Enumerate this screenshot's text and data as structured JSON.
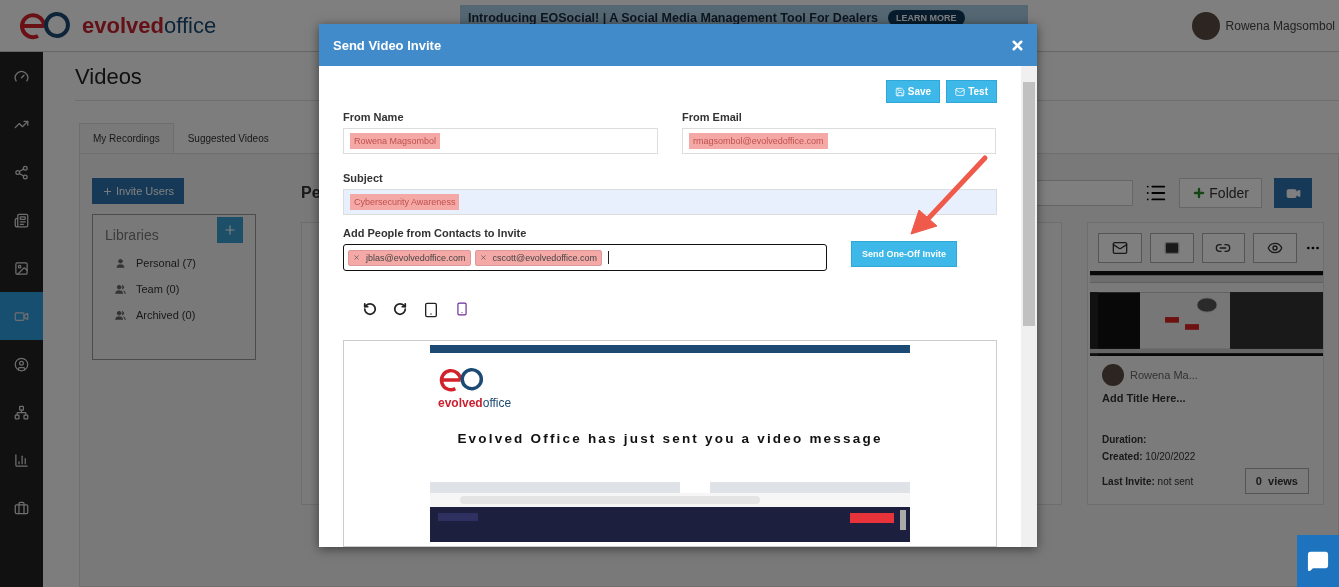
{
  "header": {
    "logo_text": [
      "evolved",
      "office"
    ],
    "banner": {
      "text": "Introducing EOSocial! | A Social Media Management Tool For Dealers",
      "button": "LEARN MORE"
    },
    "user": "Rowena Magsombol"
  },
  "sidebar": {
    "items": [
      {
        "selected": false
      },
      {
        "selected": false
      },
      {
        "selected": false
      },
      {
        "selected": false
      },
      {
        "selected": false
      },
      {
        "selected": true
      },
      {
        "selected": false
      },
      {
        "selected": false
      },
      {
        "selected": false
      },
      {
        "selected": false
      }
    ]
  },
  "page_title": "Videos",
  "tabs": [
    {
      "label": "My Recordings",
      "selected": true
    },
    {
      "label": "Suggested Videos",
      "selected": false
    }
  ],
  "invite_button": "Invite Users",
  "libraries": {
    "title": "Libraries",
    "items": [
      {
        "label": "Personal (7)",
        "kind": "single"
      },
      {
        "label": "Team (0)",
        "kind": "group"
      },
      {
        "label": "Archived (0)",
        "kind": "group"
      }
    ]
  },
  "section_heading": "Pe",
  "folder_button": "Folder",
  "card": {
    "author": "Rowena Ma...",
    "title": "Add Title Here...",
    "duration": "Duration:",
    "created_label": "Created:",
    "created": "10/20/2022",
    "last_invite_label": "Last Invite:",
    "last_invite": "not sent",
    "views_count": "0",
    "views_label": "views"
  },
  "modal": {
    "title": "Send Video Invite",
    "buttons": [
      "Save",
      "Test"
    ],
    "from_name": {
      "label": "From Name",
      "value": "Rowena Magsombol"
    },
    "from_email": {
      "label": "From Email",
      "value": "rmagsombol@evolvedoffice.com"
    },
    "subject": {
      "label": "Subject",
      "value": "Cybersecurity Awareness"
    },
    "contacts": {
      "label": "Add People from Contacts to Invite",
      "tags": [
        "jblas@evolvedoffice.com",
        "cscott@evolvedoffice.com"
      ]
    },
    "send_button": "Send One-Off Invite",
    "preview": {
      "logo_text": [
        "evolved",
        "office"
      ],
      "headline": "Evolved Office has just sent you a video message"
    }
  }
}
